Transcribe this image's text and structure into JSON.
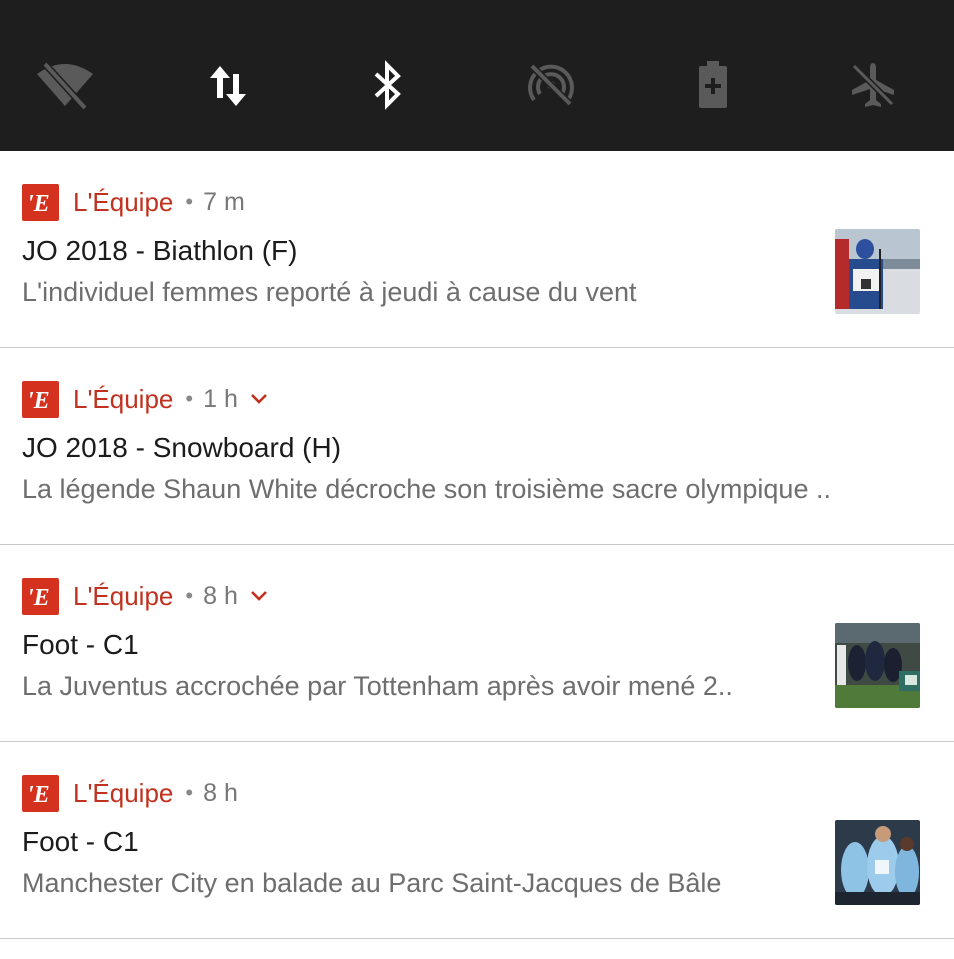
{
  "quick_settings": {
    "icons": [
      {
        "name": "wifi-off-icon",
        "state": "off"
      },
      {
        "name": "mobile-data-icon",
        "state": "on"
      },
      {
        "name": "bluetooth-icon",
        "state": "on"
      },
      {
        "name": "hotspot-off-icon",
        "state": "off"
      },
      {
        "name": "battery-saver-icon",
        "state": "off"
      },
      {
        "name": "airplane-mode-icon",
        "state": "off"
      }
    ],
    "colors": {
      "background": "#1e1e1e",
      "on": "#ffffff",
      "off": "#5a5a5a"
    }
  },
  "notifications": [
    {
      "app": "L'Équipe",
      "time": "7 m",
      "expandable": false,
      "title": "JO 2018 - Biathlon (F)",
      "text": "L'individuel femmes reporté à jeudi à cause du vent",
      "has_thumbnail": true
    },
    {
      "app": "L'Équipe",
      "time": "1 h",
      "expandable": true,
      "title": "JO 2018 - Snowboard (H)",
      "text": "La légende Shaun White décroche son troisième sacre olympique ..",
      "has_thumbnail": false
    },
    {
      "app": "L'Équipe",
      "time": "8 h",
      "expandable": true,
      "title": "Foot - C1",
      "text": "La Juventus accrochée par Tottenham après avoir mené 2..",
      "has_thumbnail": true
    },
    {
      "app": "L'Équipe",
      "time": "8 h",
      "expandable": false,
      "title": "Foot - C1",
      "text": "Manchester City en balade au Parc Saint-Jacques de Bâle",
      "has_thumbnail": true
    }
  ],
  "brand": {
    "accent": "#d4311f",
    "logo_letter": "'E"
  },
  "separator": "•"
}
